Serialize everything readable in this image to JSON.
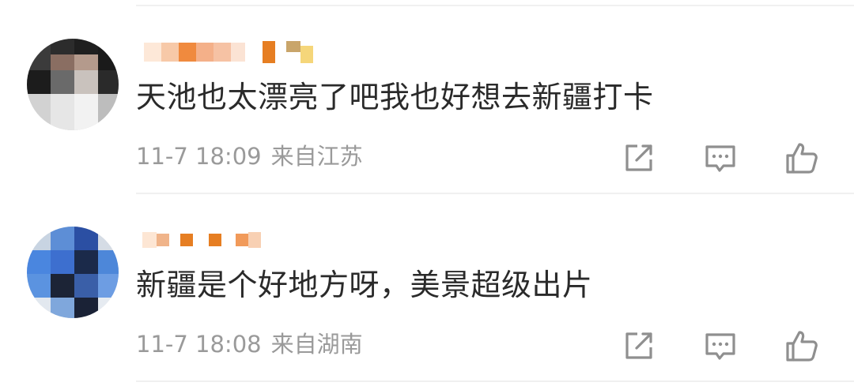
{
  "comments": [
    {
      "text": "天池也太漂亮了吧我也好想去新疆打卡",
      "time": "11-7 18:09",
      "location": "来自江苏",
      "avatar_icon": "pixelated-avatar",
      "username_icon": "pixelated-username"
    },
    {
      "text": "新疆是个好地方呀，美景超级出片",
      "time": "11-7 18:08",
      "location": "来自湖南",
      "avatar_icon": "pixelated-avatar",
      "username_icon": "pixelated-username"
    }
  ],
  "actions": {
    "share_icon": "share-icon",
    "reply_icon": "comment-icon",
    "like_icon": "thumbs-up-icon"
  },
  "colors": {
    "text": "#2a2a2a",
    "meta": "#9a9a9a",
    "icon": "#8f8f8f",
    "username_orange": "#e67e22",
    "divider": "#f0f0f0"
  }
}
